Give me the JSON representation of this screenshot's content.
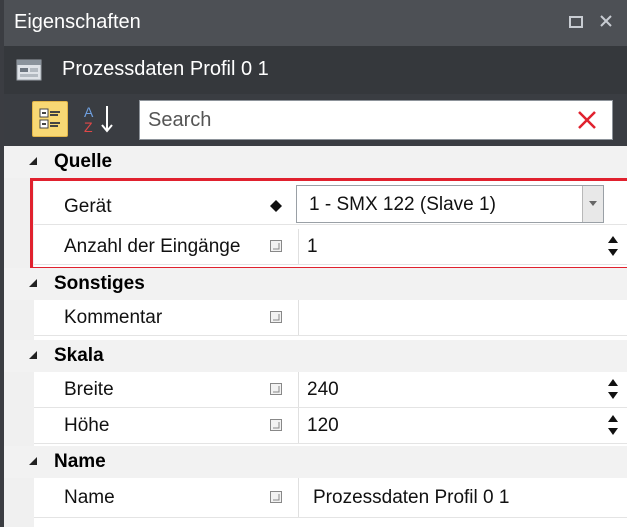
{
  "panel": {
    "title": "Eigenschaften",
    "object_title": "Prozessdaten Profil 0 1"
  },
  "toolbar": {
    "search_placeholder": "Search"
  },
  "categories": [
    {
      "label": "Quelle",
      "rows": [
        {
          "name": "Gerät",
          "value": "1 - SMX 122 (Slave 1)"
        },
        {
          "name": "Anzahl der Eingänge",
          "value": "1"
        }
      ]
    },
    {
      "label": "Sonstiges",
      "rows": [
        {
          "name": "Kommentar",
          "value": ""
        }
      ]
    },
    {
      "label": "Skala",
      "rows": [
        {
          "name": "Breite",
          "value": "240"
        },
        {
          "name": "Höhe",
          "value": "120"
        }
      ]
    },
    {
      "label": "Name",
      "rows": [
        {
          "name": "Name",
          "value": "Prozessdaten Profil 0 1"
        }
      ]
    }
  ],
  "colors": {
    "highlight": "#e0212e",
    "title_bar": "#4d5055",
    "toolbar_active": "#f8d874"
  }
}
